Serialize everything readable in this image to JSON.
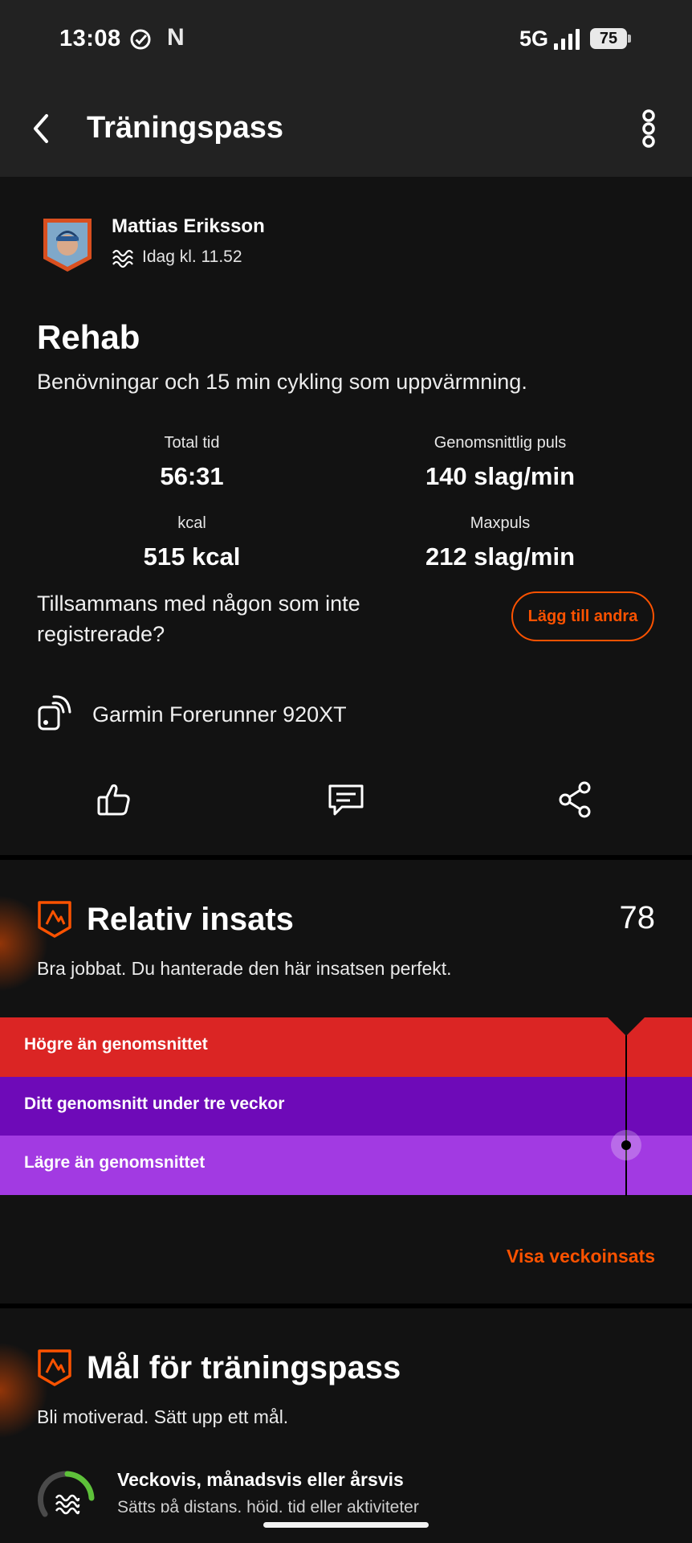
{
  "status_bar": {
    "time": "13:08",
    "netflix_letter": "N",
    "network": "5G",
    "battery": "75"
  },
  "app_bar": {
    "title": "Träningspass"
  },
  "activity": {
    "athlete_name": "Mattias Eriksson",
    "timestamp": "Idag kl. 11.52",
    "title": "Rehab",
    "description": "Benövningar och 15 min cykling som uppvärmning.",
    "stats": [
      {
        "label": "Total tid",
        "value": "56:31"
      },
      {
        "label": "Genomsnittlig puls",
        "value": "140 slag/min"
      },
      {
        "label": "kcal",
        "value": "515 kcal"
      },
      {
        "label": "Maxpuls",
        "value": "212 slag/min"
      }
    ],
    "together_prompt": "Tillsammans med någon som inte registrerade?",
    "add_others_label": "Lägg till andra",
    "device": "Garmin Forerunner 920XT"
  },
  "relative_effort": {
    "title": "Relativ insats",
    "score": "78",
    "subtitle": "Bra jobbat. Du hanterade den här insatsen perfekt.",
    "bands": [
      {
        "label": "Högre än genomsnittet",
        "color": "#db2524"
      },
      {
        "label": "Ditt genomsnitt under tre veckor",
        "color": "#6e0ab8"
      },
      {
        "label": "Lägre än genomsnittet",
        "color": "#a23ae2"
      }
    ],
    "weekly_link": "Visa veckoinsats"
  },
  "goals": {
    "title": "Mål för träningspass",
    "subtitle": "Bli motiverad. Sätt upp ett mål.",
    "item_title": "Veckovis, månadsvis eller årsvis",
    "item_subtitle": "Sätts på distans, höjd, tid eller aktiviteter"
  },
  "colors": {
    "accent": "#fc5200",
    "background": "#121212",
    "app_bar": "#222222"
  }
}
